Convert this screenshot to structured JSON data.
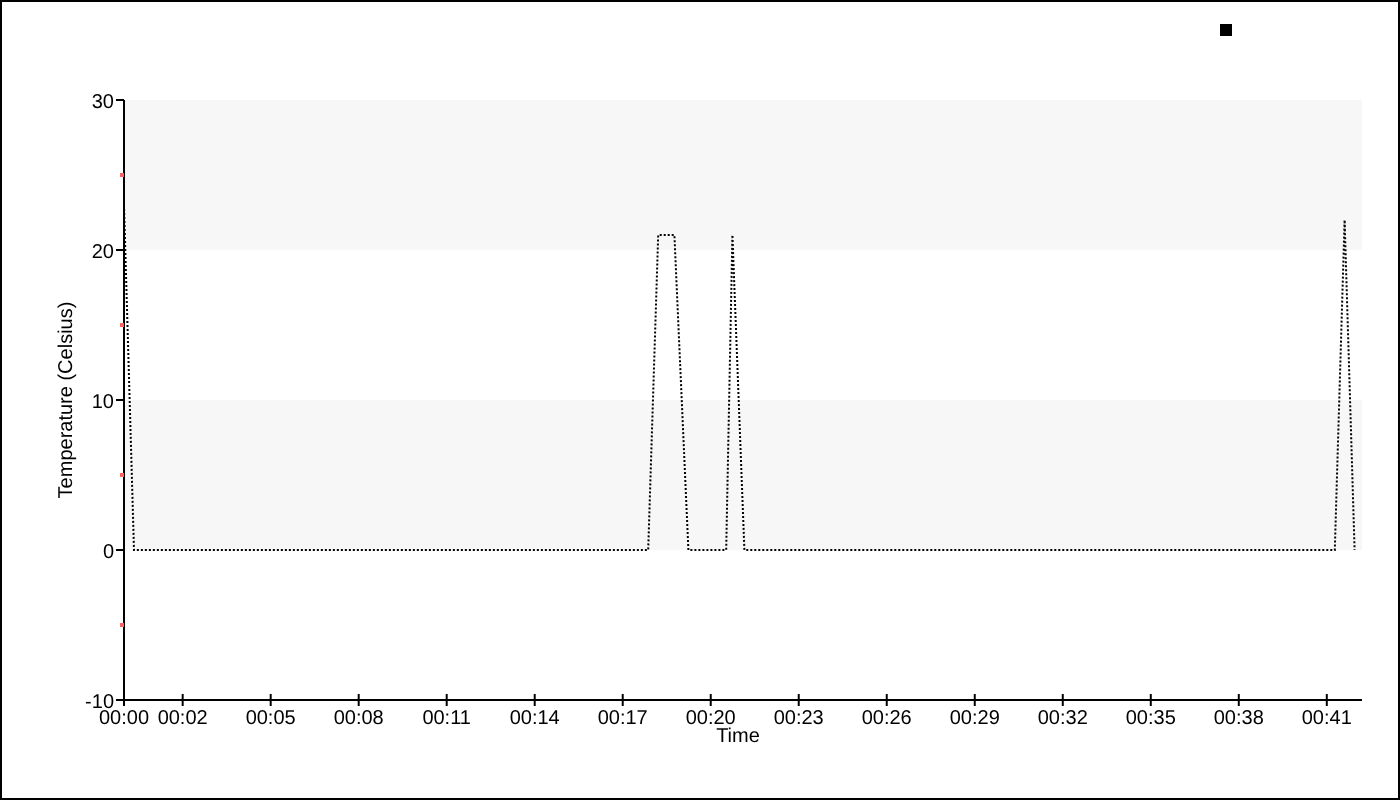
{
  "chart_data": {
    "type": "line",
    "xlabel": "Time",
    "ylabel": "Temperature (Celsius)",
    "x": [
      0,
      0.34,
      17.87,
      18.21,
      18.76,
      19.24,
      20.53,
      20.74,
      21.15,
      41.27,
      41.61,
      41.95
    ],
    "series": [
      {
        "color": "#000000",
        "line_style": "dotted",
        "values": [
          23,
          0,
          0,
          21,
          21,
          0,
          0,
          21,
          0,
          0,
          22,
          0
        ]
      }
    ],
    "xlim": [
      0,
      42.2
    ],
    "ylim": [
      -10,
      30
    ],
    "xticks": [
      {
        "value": 0,
        "label": "00:00"
      },
      {
        "value": 2,
        "label": "00:02"
      },
      {
        "value": 5,
        "label": "00:05"
      },
      {
        "value": 8,
        "label": "00:08"
      },
      {
        "value": 11,
        "label": "00:11"
      },
      {
        "value": 14,
        "label": "00:14"
      },
      {
        "value": 17,
        "label": "00:17"
      },
      {
        "value": 20,
        "label": "00:20"
      },
      {
        "value": 23,
        "label": "00:23"
      },
      {
        "value": 26,
        "label": "00:26"
      },
      {
        "value": 29,
        "label": "00:29"
      },
      {
        "value": 32,
        "label": "00:32"
      },
      {
        "value": 35,
        "label": "00:35"
      },
      {
        "value": 38,
        "label": "00:38"
      },
      {
        "value": 41,
        "label": "00:41"
      }
    ],
    "yticks": [
      -10,
      0,
      10,
      20,
      30
    ]
  }
}
